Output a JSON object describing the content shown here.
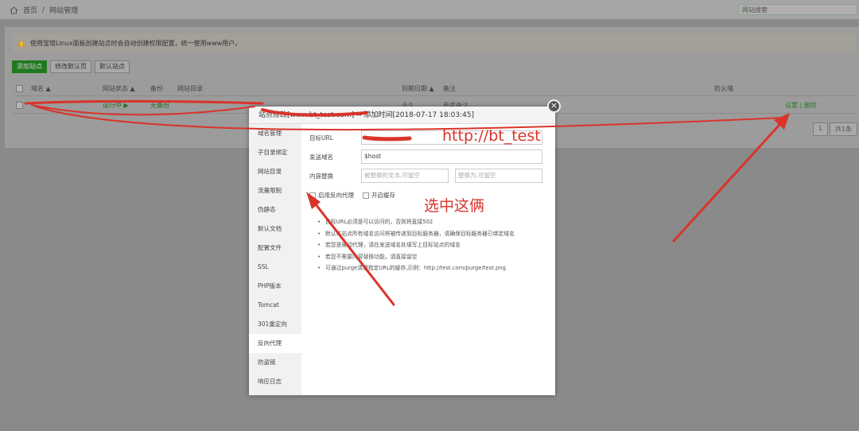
{
  "header": {
    "breadcrumb_home": "首页",
    "breadcrumb_sep": "/",
    "breadcrumb_page": "网站管理",
    "search_placeholder": "网站搜索"
  },
  "notice": "使用宝塔Linux面板创建站点时会自动创建权限配置，统一使用www用户。",
  "toolbar": {
    "add_site": "添加站点",
    "edit_default": "修改默认页",
    "default_site": "默认站点"
  },
  "table": {
    "headers": [
      "域名 ▲",
      "网站状态 ▲",
      "备份",
      "网站目录",
      "到期日期 ▲",
      "备注",
      "防火墙"
    ],
    "row": {
      "status": "运行中 ▶",
      "backup": "无备份",
      "expire": "永久",
      "note": "参考备注",
      "ops": "设置 | 删除"
    }
  },
  "pager": {
    "page": "1",
    "total": "共1条"
  },
  "dialog": {
    "title": "站点修改[www.bt_test.com] -- 添加时间[2018-07-17 18:03:45]",
    "close": "×",
    "menu": [
      "域名管理",
      "子目录绑定",
      "网站目录",
      "流量限制",
      "伪静态",
      "默认文档",
      "配置文件",
      "SSL",
      "PHP版本",
      "Tomcat",
      "301重定向",
      "反向代理",
      "防盗链",
      "响应日志"
    ],
    "form": {
      "target_url_label": "目标URL",
      "target_url_value": "http://bt_test",
      "send_domain_label": "发送域名",
      "send_domain_value": "$host",
      "replace_label": "内容替换",
      "replace_from_placeholder": "被替换的文本,可留空",
      "replace_to_placeholder": "替换为,可留空",
      "enable_proxy_label": "启用反向代理",
      "enable_cache_label": "开启缓存"
    },
    "tips": [
      "目标URL必须是可以访问的，否则将直接502",
      "默认本站点所有域名访问将被传递到目标服务器，请确保目标服务器已绑定域名",
      "若您是被动代理，请在发送域名处填写上目标站点的域名",
      "若您不需要内容替换功能，请直接留空",
      "可通过purge清理指定URL的缓存,示例：http://test.com/purge/test.png"
    ]
  },
  "annotations": {
    "url_note": "http://bt_test",
    "select_note": "选中这俩"
  },
  "colors": {
    "annotation": "#d9342b",
    "primary": "#20a53a"
  }
}
